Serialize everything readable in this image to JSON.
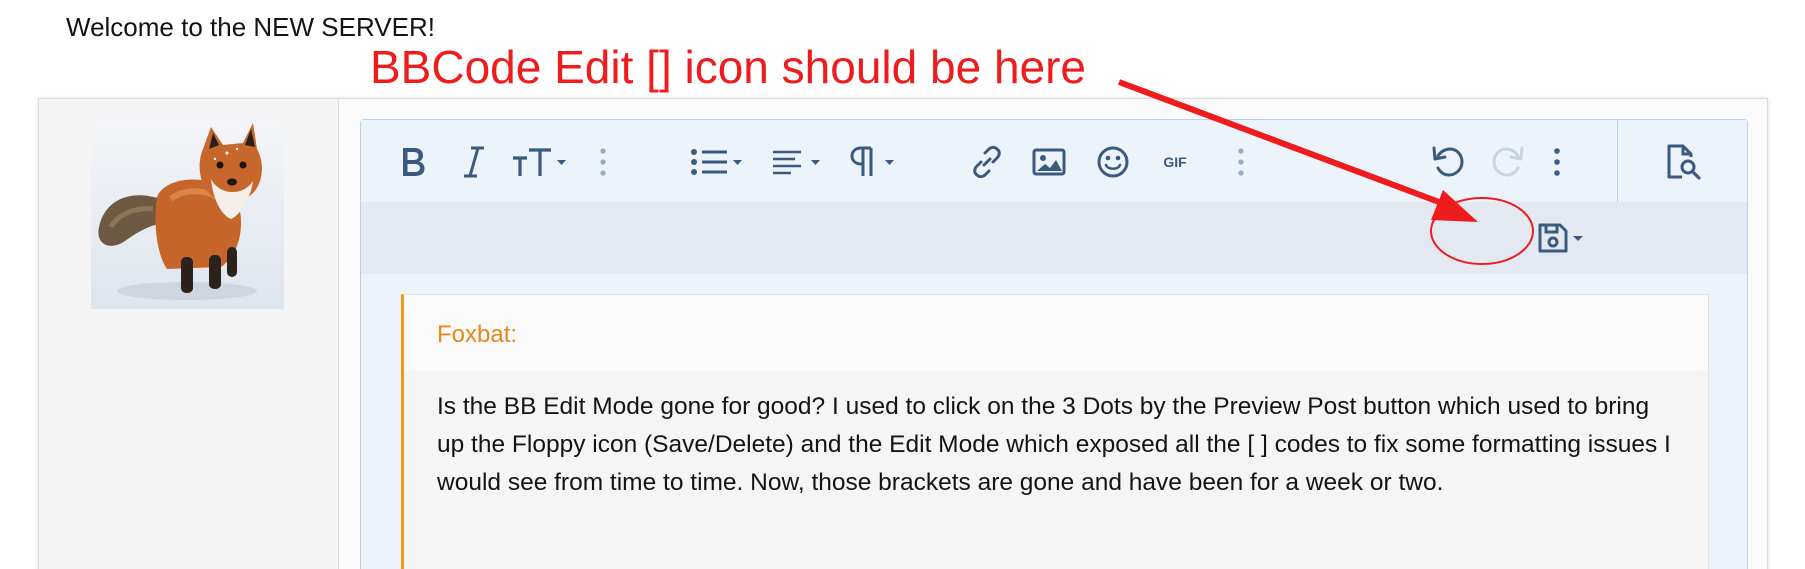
{
  "page": {
    "welcome_text": "Welcome to the NEW SERVER!"
  },
  "annotation": {
    "text": "BBCode Edit [] icon should be here",
    "color": "#ee1c1c"
  },
  "toolbar": {
    "icons": [
      "bold-icon",
      "italic-icon",
      "text-size-icon",
      "more-text-options-icon",
      "list-icon",
      "align-icon",
      "paragraph-icon",
      "link-icon",
      "image-icon",
      "smilie-icon",
      "gif-icon",
      "more-insert-options-icon",
      "undo-icon",
      "redo-icon",
      "more-options-icon",
      "preview-icon"
    ],
    "gif_label": "GIF",
    "accent_color": "#3a5a80"
  },
  "subbar": {
    "icons": [
      "floppy-disk-icon",
      "chevron-down-icon"
    ]
  },
  "quote": {
    "author": "Foxbat:",
    "body": "Is the BB Edit Mode gone for good? I used to click on the 3 Dots by the Preview Post button which used to bring up the Floppy icon (Save/Delete) and the Edit Mode which exposed all the [ ] codes to fix some formatting issues I would see from time to time. Now, those brackets are gone and have been for a week or two.",
    "accent_color": "#f09b14"
  }
}
